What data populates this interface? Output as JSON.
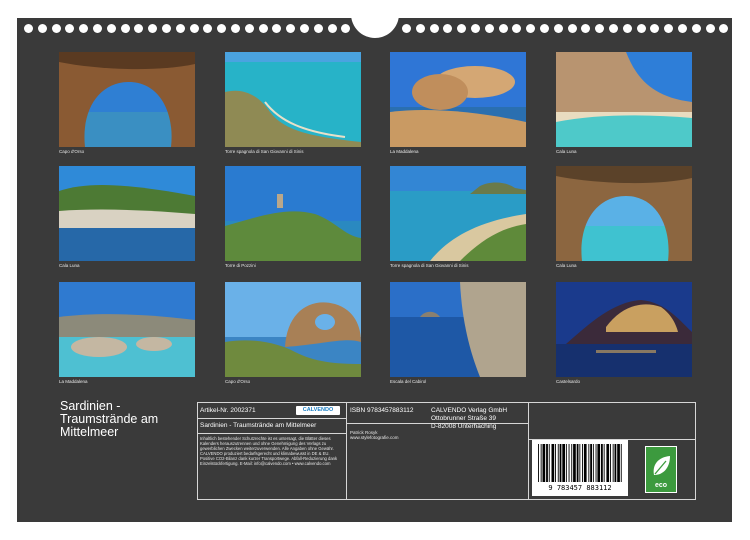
{
  "photos": [
    {
      "caption": "Capo d'Orso",
      "scene": "cave-arch",
      "sky": "#2f7fd3",
      "sea": "#3a8fc2",
      "land": "#8a5a33"
    },
    {
      "caption": "Torre spagnola di San Giovanni di Sinis",
      "scene": "coast-aerial",
      "sky": "#4aa3e0",
      "sea": "#27b3c8",
      "land": "#8f8a54"
    },
    {
      "caption": "La Maddalena",
      "scene": "rocks",
      "sky": "#2f76d6",
      "sea": "#2a6fb0",
      "land": "#c99a63"
    },
    {
      "caption": "Cala Luna",
      "scene": "beach-cliff",
      "sky": "#2e7ed8",
      "sea": "#4ec9c9",
      "land": "#b89470"
    },
    {
      "caption": "Cala Luna",
      "scene": "green-cliff",
      "sky": "#2f8ad8",
      "sea": "#2668a8",
      "land": "#4d7a34"
    },
    {
      "caption": "Torre di Pozzini",
      "scene": "tower",
      "sky": "#2a7bd0",
      "sea": "#2a89c0",
      "land": "#5e8a3c"
    },
    {
      "caption": "Torre spagnola di San Giovanni di Sinis",
      "scene": "bay",
      "sky": "#3386d4",
      "sea": "#2a9cc6",
      "land": "#d9c8a0"
    },
    {
      "caption": "Cala Luna",
      "scene": "cave-arch",
      "sky": "#5ab1e6",
      "sea": "#3fc2d0",
      "land": "#8c6640"
    },
    {
      "caption": "La Maddalena",
      "scene": "rocky-shore",
      "sky": "#2f7ad0",
      "sea": "#4ec0d2",
      "land": "#c4b7a2"
    },
    {
      "caption": "Capo d'Orso",
      "scene": "granite",
      "sky": "#6ab1e8",
      "sea": "#3b85c4",
      "land": "#a88056"
    },
    {
      "caption": "Escala del Cabirol",
      "scene": "sea-cliff",
      "sky": "#2b6fc8",
      "sea": "#1e58a6",
      "land": "#b0a48e"
    },
    {
      "caption": "Castelsardo",
      "scene": "night-town",
      "sky": "#1a3a8c",
      "sea": "#16306e",
      "land": "#c9a060"
    }
  ],
  "title": "Sardinien - Traumstrände am Mittelmeer",
  "info": {
    "article": "Artikel-Nr. 2002371",
    "calvendo_logo": "CALVENDO",
    "subtitle": "Sardinien - Traumstrände am Mittelmeer",
    "legal": "Inhaltlich bestehender Schutzrechte ist es untersagt, die Blätter dieses Kalenders herauszutrennen und ohne Genehmigung des Verlags zu gewerblichen Zwecken weiterzuverwenden. Alle Angaben ohne Gewähr. CALVENDO produziert bedarfsgerecht und klimabewusst in DE & EU. Positive CO2-Bilanz dank kurzer Transportwege. Abfall-Reduzierung dank Einzelstückfertigung. E-Mail: info@calvendo.com • www.calvendo.com",
    "isbn": "ISBN 9783457883112",
    "photographer_name": "Patrick Rosyk",
    "photographer_url": "www.stylefotografie.com",
    "publisher": "CALVENDO Verlag GmbH",
    "street": "Ottobrunner Straße 39",
    "city": "D-82008 Unterhaching",
    "barcode_number": "9 783457 883112",
    "eco_label": "eco"
  }
}
